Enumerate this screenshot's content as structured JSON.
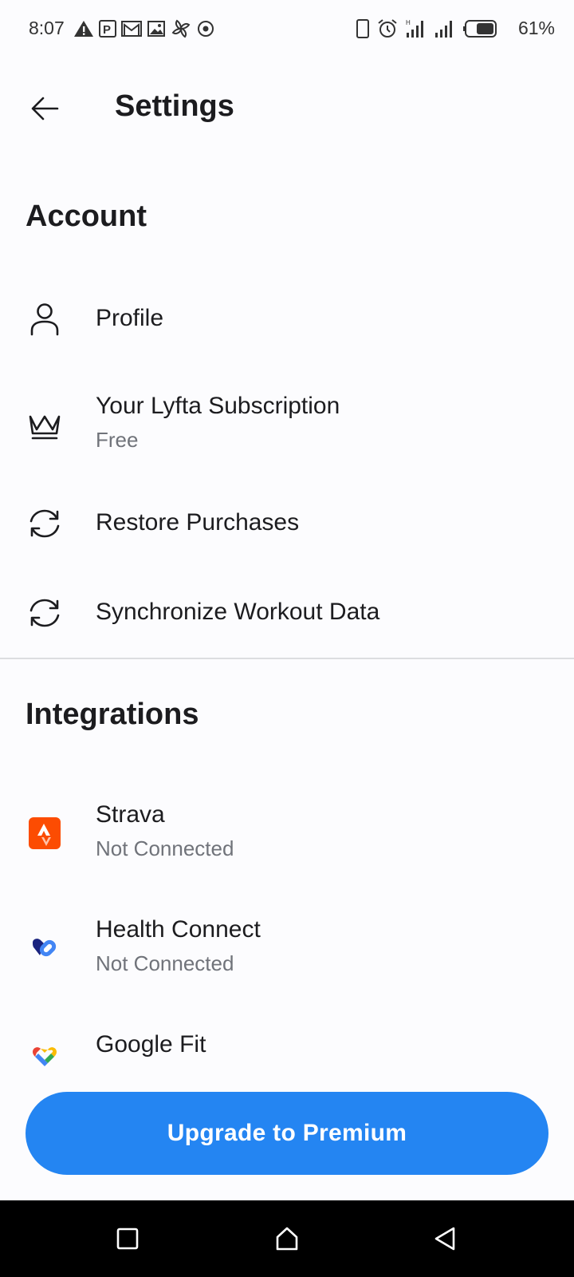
{
  "status_bar": {
    "time": "8:07",
    "battery": "61%",
    "left_icons": [
      "warning-icon",
      "parking-icon",
      "gmail-icon",
      "image-icon",
      "pinwheel-icon",
      "target-icon"
    ],
    "right_icons": [
      "phone-icon",
      "alarm-icon",
      "signal-icon",
      "signal-icon",
      "battery-icon"
    ]
  },
  "header": {
    "title": "Settings",
    "back_icon": "back-arrow-icon"
  },
  "account": {
    "title": "Account",
    "items": [
      {
        "label": "Profile",
        "icon": "person-icon"
      },
      {
        "label": "Your Lyfta Subscription",
        "sub": "Free",
        "icon": "crown-icon"
      },
      {
        "label": "Restore Purchases",
        "icon": "sync-icon"
      },
      {
        "label": "Synchronize Workout Data",
        "icon": "sync-icon"
      }
    ]
  },
  "integrations": {
    "title": "Integrations",
    "items": [
      {
        "label": "Strava",
        "sub": "Not Connected",
        "icon": "strava-icon"
      },
      {
        "label": "Health Connect",
        "sub": "Not Connected",
        "icon": "health-connect-icon"
      },
      {
        "label": "Google Fit",
        "icon": "google-fit-icon"
      }
    ]
  },
  "upgrade": {
    "label": "Upgrade to Premium"
  },
  "colors": {
    "accent": "#2485f2",
    "strava": "#fc4c02",
    "text": "#1c1c1f",
    "muted": "#70737a"
  },
  "nav": {
    "icons": [
      "recent-apps-icon",
      "home-icon",
      "back-icon"
    ]
  }
}
